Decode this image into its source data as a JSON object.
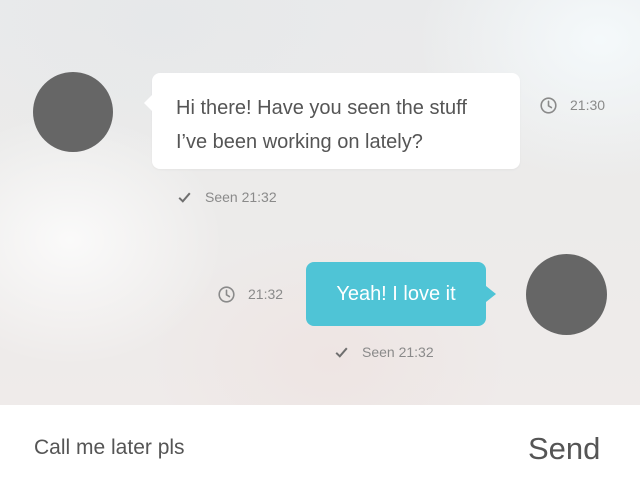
{
  "messages": [
    {
      "direction": "incoming",
      "text": "Hi there! Have you seen the stuff I’ve been working on lately?",
      "time": "21:30",
      "seen": "Seen 21:32"
    },
    {
      "direction": "outgoing",
      "text": "Yeah! I love it",
      "time": "21:32",
      "seen": "Seen 21:32"
    }
  ],
  "composer": {
    "input_value": "Call me later pls",
    "send_label": "Send"
  },
  "icons": {
    "time": "clock-icon",
    "seen": "check-icon"
  },
  "colors": {
    "outgoing_bubble": "#4fc4d6",
    "incoming_bubble": "#ffffff",
    "avatar": "#666666",
    "text": "#555555",
    "meta_text": "#8a8a8a"
  }
}
